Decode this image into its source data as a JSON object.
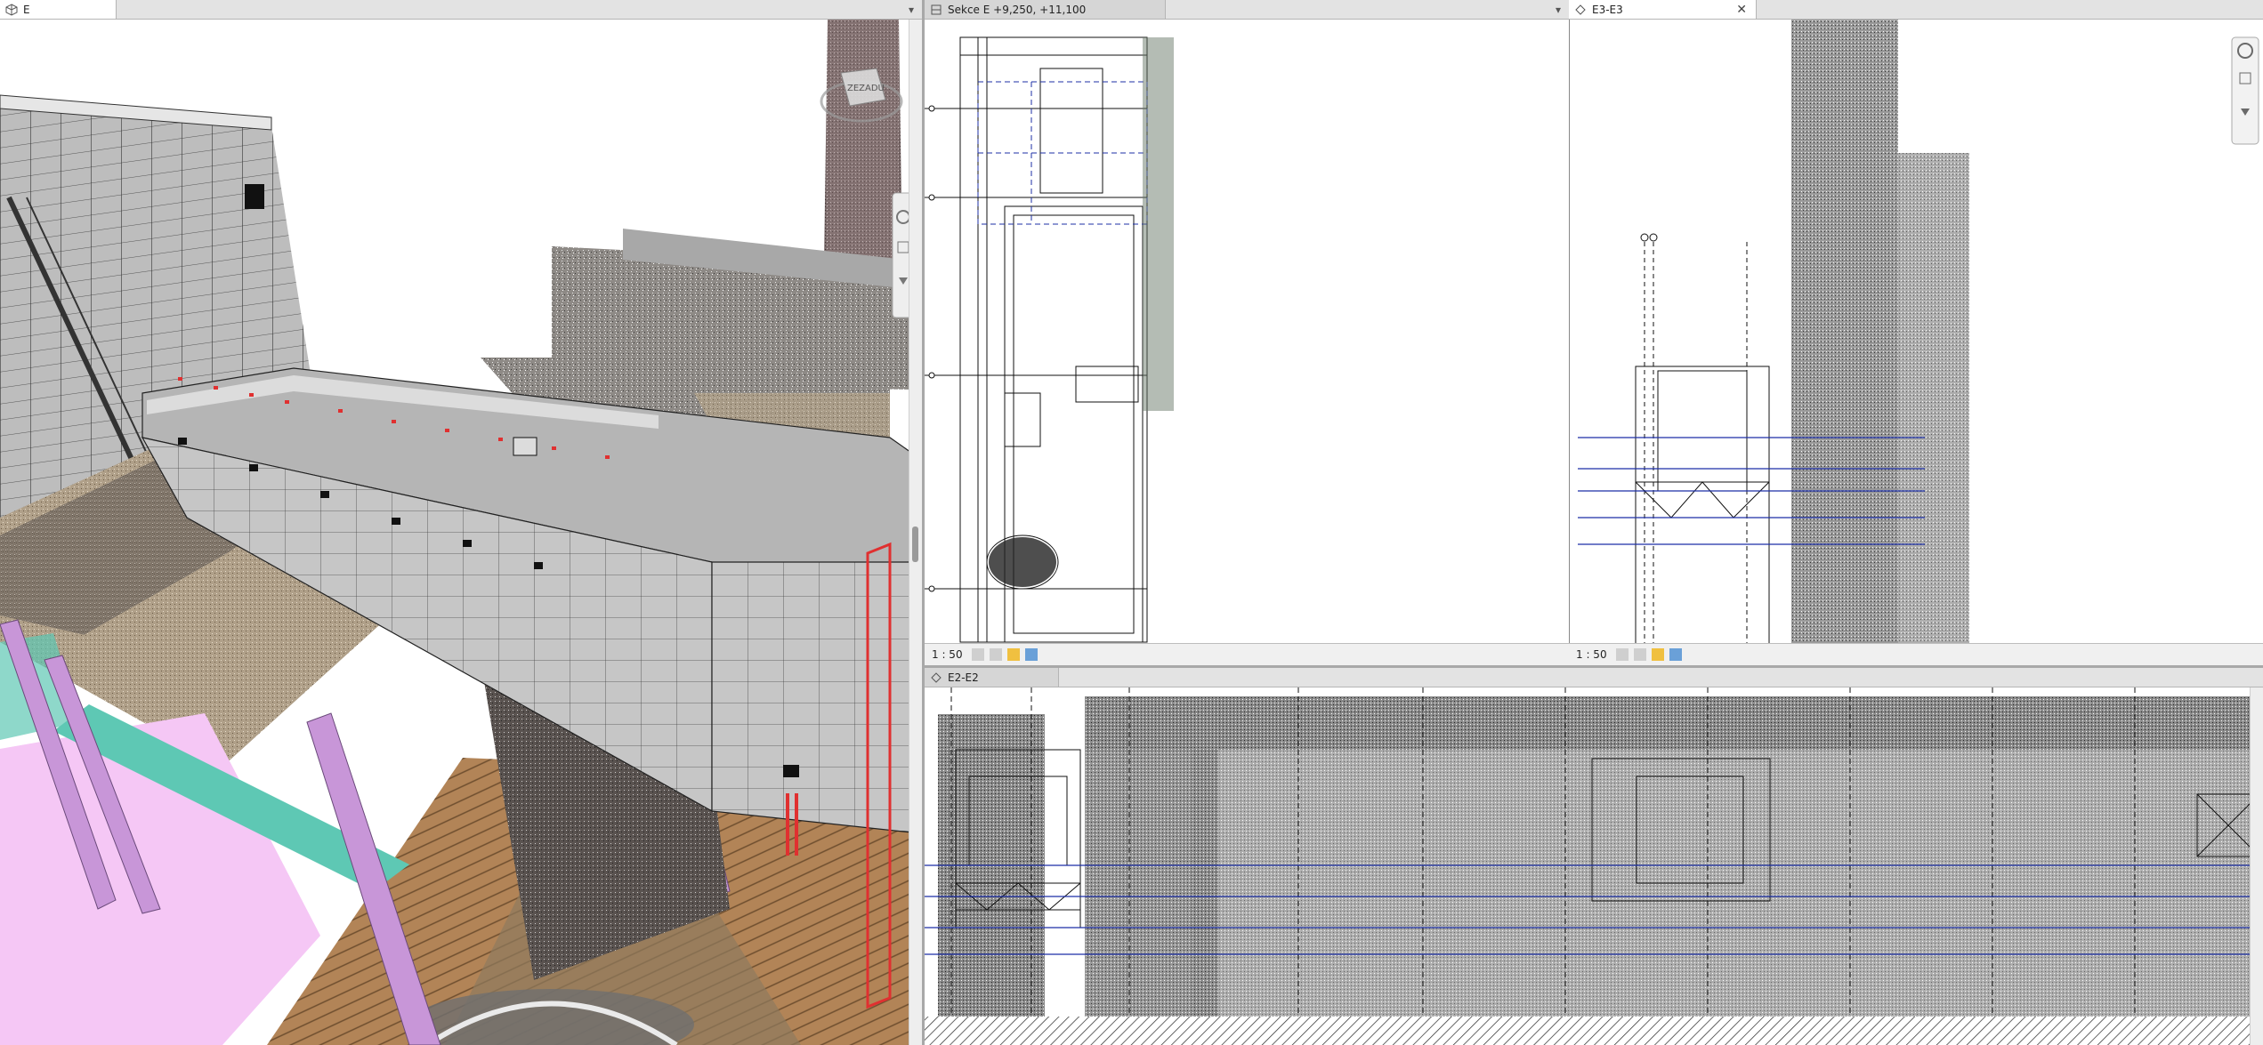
{
  "views": {
    "main3d": {
      "title": "E",
      "viewcube_label": "ZEZADU"
    },
    "section": {
      "title": "Sekce E +9,250, +11,100",
      "scale": "1 : 50"
    },
    "elev_e3": {
      "title": "E3-E3",
      "scale": "1 : 50"
    },
    "elev_e2": {
      "title": "E2-E2"
    }
  },
  "colors": {
    "titlebar": "#e3e3e3",
    "model_gray": "#a9a9a9",
    "model_light": "#c6c6c6",
    "steel_purple": "#c896d8",
    "floor_pink": "#f5c7f5",
    "ground_brown": "#b28457",
    "teal_steel": "#5ec8b4",
    "red_bracing": "#e03030",
    "grid_blue": "#1c2fa6"
  },
  "icons": [
    "view-3d-icon",
    "section-view-icon",
    "elevation-view-icon",
    "close-icon",
    "dropdown-arrow-icon",
    "navigation-wheel-icon",
    "zoom-icon",
    "view-control-icon"
  ]
}
